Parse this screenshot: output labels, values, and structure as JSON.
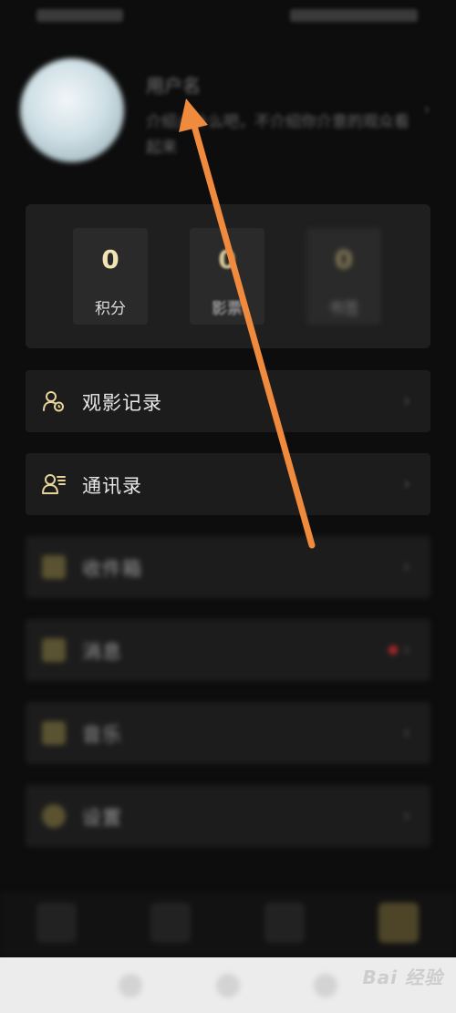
{
  "profile": {
    "username": "用户名",
    "signature": "介绍点什么吧，不介绍你介意的观众看起来"
  },
  "stats": [
    {
      "value": "0",
      "label": "积分"
    },
    {
      "value": "0",
      "label": "影票"
    },
    {
      "value": "0",
      "label": "书签"
    }
  ],
  "menu": [
    {
      "label": "观影记录",
      "icon": "user-history-icon"
    },
    {
      "label": "通讯录",
      "icon": "contacts-icon"
    },
    {
      "label": "收件箱",
      "icon": "inbox-icon"
    },
    {
      "label": "消息",
      "icon": "messages-icon"
    },
    {
      "label": "音乐",
      "icon": "music-icon"
    },
    {
      "label": "设置",
      "icon": "settings-icon"
    }
  ],
  "watermark": "Bai 经验",
  "colors": {
    "background": "#0d0d0d",
    "accent_gold": "#f2e3b3",
    "icon_gold": "#e8d49a",
    "arrow": "#f08a3c",
    "badge": "#b0282a"
  }
}
